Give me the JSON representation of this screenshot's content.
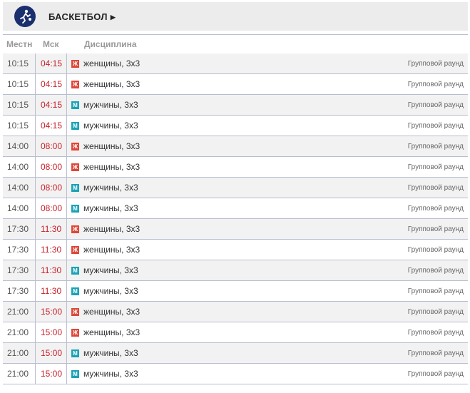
{
  "header": {
    "title": "БАСКЕТБОЛ",
    "logo_icon": "basketball-player-icon",
    "logo_color": "#1a2f6e"
  },
  "columns": {
    "local": "Местн",
    "msk": "Мск",
    "discipline": "Дисциплина"
  },
  "colors": {
    "msk_time": "#c8202a",
    "badge_women": "#e04638",
    "badge_men": "#1aa2b6"
  },
  "rows": [
    {
      "local": "10:15",
      "msk": "04:15",
      "badge": "Ж",
      "gender": "w",
      "discipline": "женщины, 3х3",
      "stage": "Групповой раунд"
    },
    {
      "local": "10:15",
      "msk": "04:15",
      "badge": "Ж",
      "gender": "w",
      "discipline": "женщины, 3х3",
      "stage": "Групповой раунд"
    },
    {
      "local": "10:15",
      "msk": "04:15",
      "badge": "М",
      "gender": "m",
      "discipline": "мужчины, 3х3",
      "stage": "Групповой раунд"
    },
    {
      "local": "10:15",
      "msk": "04:15",
      "badge": "М",
      "gender": "m",
      "discipline": "мужчины, 3х3",
      "stage": "Групповой раунд"
    },
    {
      "local": "14:00",
      "msk": "08:00",
      "badge": "Ж",
      "gender": "w",
      "discipline": "женщины, 3х3",
      "stage": "Групповой раунд"
    },
    {
      "local": "14:00",
      "msk": "08:00",
      "badge": "Ж",
      "gender": "w",
      "discipline": "женщины, 3х3",
      "stage": "Групповой раунд"
    },
    {
      "local": "14:00",
      "msk": "08:00",
      "badge": "М",
      "gender": "m",
      "discipline": "мужчины, 3х3",
      "stage": "Групповой раунд"
    },
    {
      "local": "14:00",
      "msk": "08:00",
      "badge": "М",
      "gender": "m",
      "discipline": "мужчины, 3х3",
      "stage": "Групповой раунд"
    },
    {
      "local": "17:30",
      "msk": "11:30",
      "badge": "Ж",
      "gender": "w",
      "discipline": "женщины, 3х3",
      "stage": "Групповой раунд"
    },
    {
      "local": "17:30",
      "msk": "11:30",
      "badge": "Ж",
      "gender": "w",
      "discipline": "женщины, 3х3",
      "stage": "Групповой раунд"
    },
    {
      "local": "17:30",
      "msk": "11:30",
      "badge": "М",
      "gender": "m",
      "discipline": "мужчины, 3х3",
      "stage": "Групповой раунд"
    },
    {
      "local": "17:30",
      "msk": "11:30",
      "badge": "М",
      "gender": "m",
      "discipline": "мужчины, 3х3",
      "stage": "Групповой раунд"
    },
    {
      "local": "21:00",
      "msk": "15:00",
      "badge": "Ж",
      "gender": "w",
      "discipline": "женщины, 3х3",
      "stage": "Групповой раунд"
    },
    {
      "local": "21:00",
      "msk": "15:00",
      "badge": "Ж",
      "gender": "w",
      "discipline": "женщины, 3х3",
      "stage": "Групповой раунд"
    },
    {
      "local": "21:00",
      "msk": "15:00",
      "badge": "М",
      "gender": "m",
      "discipline": "мужчины, 3х3",
      "stage": "Групповой раунд"
    },
    {
      "local": "21:00",
      "msk": "15:00",
      "badge": "М",
      "gender": "m",
      "discipline": "мужчины, 3х3",
      "stage": "Групповой раунд"
    }
  ]
}
